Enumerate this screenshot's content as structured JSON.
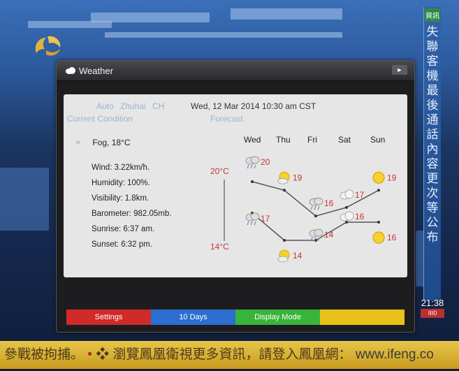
{
  "window": {
    "title": "Weather",
    "location": {
      "auto": "Auto",
      "city": "Zhuhai",
      "country": "CH"
    },
    "datetime": "Wed, 12 Mar 2014 10:30 am CST",
    "current_section": "Current Condition",
    "forecast_section": "Forecast",
    "current": {
      "condition": "Fog, 18°C",
      "details": [
        "Wind: 3.22km/h.",
        "Humidity: 100%.",
        "Visibility: 1.8km.",
        "Barometer: 982.05mb.",
        "Sunrise: 6:37 am.",
        "Sunset: 6:32 pm."
      ]
    },
    "forecast": {
      "max_label": "20°C",
      "min_label": "14°C",
      "days": [
        {
          "name": "Wed",
          "high": 20,
          "low": 17,
          "high_icon": "rain-cloud-icon",
          "low_icon": "rain-cloud-icon"
        },
        {
          "name": "Thu",
          "high": 19,
          "low": 14,
          "high_icon": "sun-cloud-icon",
          "low_icon": "sun-cloud-icon"
        },
        {
          "name": "Fri",
          "high": 16,
          "low": 14,
          "high_icon": "rain-cloud-icon",
          "low_icon": "rain-cloud-icon"
        },
        {
          "name": "Sat",
          "high": 17,
          "low": 16,
          "high_icon": "cloud-icon",
          "low_icon": "cloud-icon"
        },
        {
          "name": "Sun",
          "high": 19,
          "low": 16,
          "high_icon": "sun-icon",
          "low_icon": "sun-icon"
        }
      ]
    },
    "footer_buttons": [
      {
        "label": "Settings",
        "color": "#d02a2a"
      },
      {
        "label": "10 Days",
        "color": "#2c6fd0"
      },
      {
        "label": "Display Mode",
        "color": "#39b43a"
      },
      {
        "label": "",
        "color": "#e8c21a"
      }
    ]
  },
  "ticker": {
    "text1": "參戰被拘捕。",
    "text2": "瀏覽鳳凰衛視更多資訊，請登入鳳凰網：",
    "url": "www.ifeng.co"
  },
  "side_strip": {
    "badge": "資訊",
    "text": "失聯客機最後通話內容更次等公布",
    "clock": "21:38",
    "channel": "III0"
  },
  "colors": {
    "panel": "#e6e6e6",
    "accent_temp": "#cc3333",
    "label_blue": "#9ab3d8"
  }
}
